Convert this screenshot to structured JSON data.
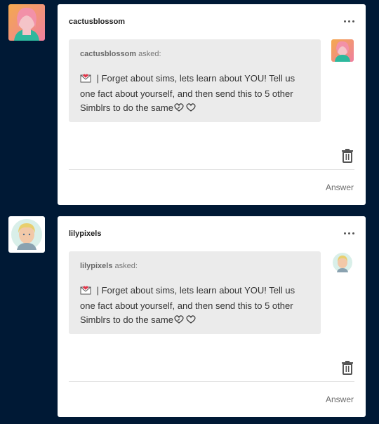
{
  "posts": [
    {
      "blog_name": "cactusblossom",
      "asker": "cactusblossom",
      "asked_label": "asked:",
      "question": " | Forget about sims, lets learn about YOU! Tell us one fact about yourself, and then send this to 5 other Simblrs to do the same",
      "answer_label": "Answer",
      "avatar_theme": "pink-portrait"
    },
    {
      "blog_name": "lilypixels",
      "asker": "lilypixels",
      "asked_label": "asked:",
      "question": " | Forget about sims, lets learn about YOU! Tell us one fact about yourself, and then send this to 5 other Simblrs to do the same",
      "answer_label": "Answer",
      "avatar_theme": "blonde-sim-portrait"
    }
  ],
  "icons": {
    "menu": "more-horizontal-icon",
    "trash": "trash-icon",
    "envelope": "love-letter-icon",
    "hearts": "heart-icons"
  },
  "colors": {
    "page_bg": "#001935",
    "card_bg": "#ffffff",
    "ask_bg": "#ebebeb"
  }
}
